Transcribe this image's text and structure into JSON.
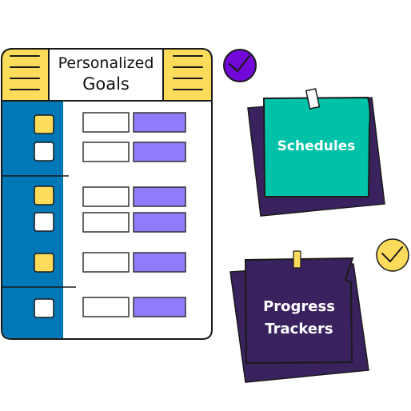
{
  "colors": {
    "yellow": "#FDDC5C",
    "blue": "#0077B6",
    "purple_field": "#8E7CFB",
    "check_purple": "#7209D9",
    "teal": "#00C2A8",
    "dark_purple": "#3A225F",
    "outline": "#1a1a1a"
  },
  "goals_card": {
    "title_line1": "Personalized",
    "title_line2": "Goals",
    "sections": [
      {
        "rows": [
          {
            "checkbox": "yellow"
          },
          {
            "checkbox": "white"
          }
        ]
      },
      {
        "rows": [
          {
            "checkbox": "yellow"
          },
          {
            "checkbox": "white"
          },
          {
            "checkbox": "yellow"
          }
        ]
      },
      {
        "rows": [
          {
            "checkbox": "white"
          }
        ]
      }
    ]
  },
  "notes": {
    "schedules": {
      "label": "Schedules"
    },
    "progress": {
      "label_line1": "Progress",
      "label_line2": "Trackers"
    }
  },
  "icons": {
    "check_top": "check-circle-icon",
    "check_bottom": "check-circle-icon"
  }
}
